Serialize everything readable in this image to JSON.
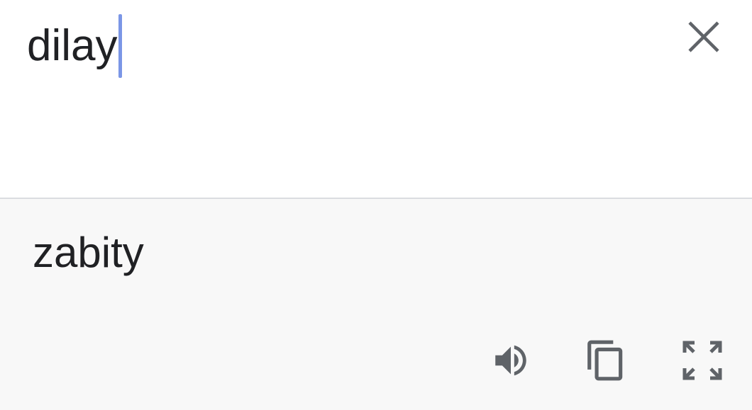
{
  "input": {
    "source_text": "dilay",
    "clear_icon": "close-icon"
  },
  "output": {
    "translated_text": "zabity",
    "actions": [
      {
        "name": "listen",
        "icon": "speaker-icon"
      },
      {
        "name": "copy",
        "icon": "copy-icon"
      },
      {
        "name": "fullscreen",
        "icon": "fullscreen-icon"
      }
    ]
  },
  "colors": {
    "text": "#202124",
    "icon": "#5f6368",
    "caret": "#7b96e6",
    "output_background": "#f8f8f8",
    "divider": "#dadce0"
  }
}
